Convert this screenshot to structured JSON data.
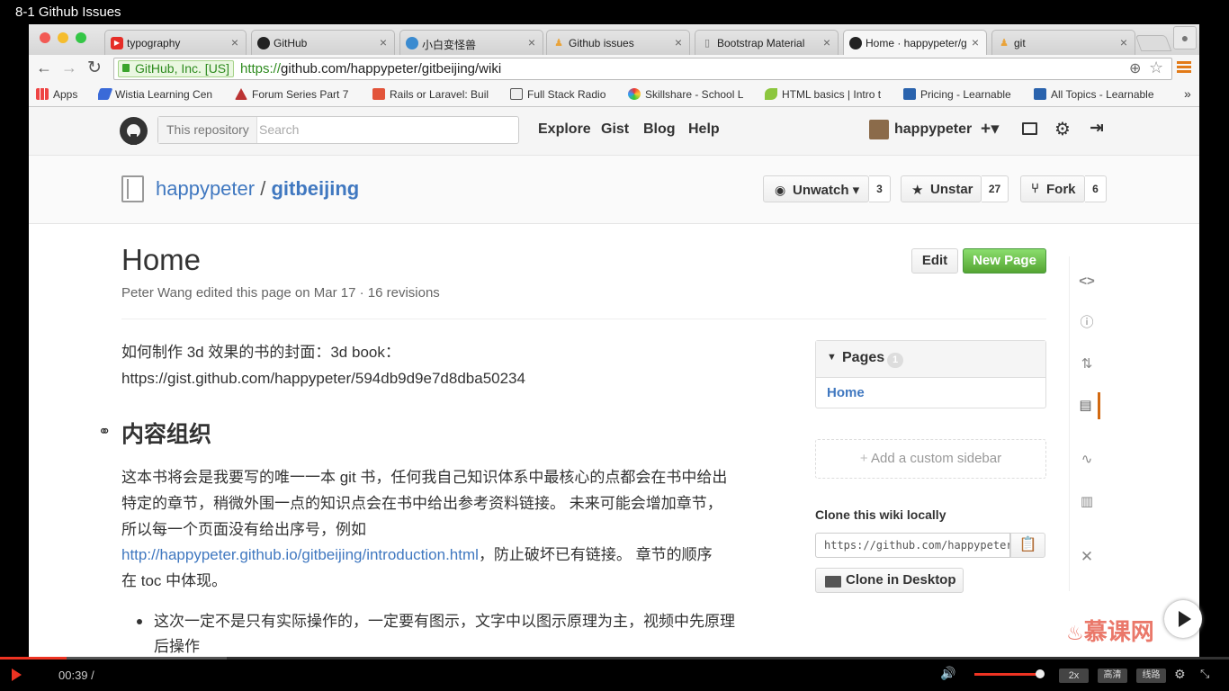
{
  "video": {
    "title": "8-1 Github Issues",
    "time": "00:39 /",
    "speed": "2x",
    "quality": "高清",
    "route": "线路",
    "watermark": "慕课网"
  },
  "browser": {
    "tabs": [
      {
        "label": "typography",
        "icon": "youtube-icon"
      },
      {
        "label": "GitHub",
        "icon": "github-icon"
      },
      {
        "label": "小白变怪兽",
        "icon": "earth-icon"
      },
      {
        "label": "Github issues",
        "icon": "people-icon"
      },
      {
        "label": "Bootstrap Material",
        "icon": "page-icon"
      },
      {
        "label": "Home · happypeter/g",
        "icon": "github-icon"
      },
      {
        "label": "git",
        "icon": "people-icon"
      }
    ],
    "ev_cert": "GitHub, Inc. [US]",
    "url_scheme": "https://",
    "url_rest": "github.com/happypeter/gitbeijing/wiki",
    "bookmarks": [
      "Apps",
      "Wistia Learning Cen",
      "Forum Series Part 7",
      "Rails or Laravel: Buil",
      "Full Stack Radio",
      "Skillshare - School L",
      "HTML basics | Intro t",
      "Pricing - Learnable",
      "All Topics - Learnable"
    ],
    "bookmarks_more": "»"
  },
  "github": {
    "search_scope": "This repository",
    "search_placeholder": "Search",
    "nav": [
      "Explore",
      "Gist",
      "Blog",
      "Help"
    ],
    "username": "happypeter",
    "plus": "+▾",
    "owner": "happypeter",
    "sep": "/",
    "repo": "gitbeijing",
    "unwatch": "Unwatch ▾",
    "watch_count": "3",
    "unstar": "Unstar",
    "star_count": "27",
    "fork": "Fork",
    "fork_count": "6"
  },
  "wiki": {
    "title": "Home",
    "meta": "Peter Wang edited this page on Mar 17 · 16 revisions",
    "edit": "Edit",
    "new_page": "New Page",
    "intro": "如何制作 3d 效果的书的封面：3d book：",
    "intro_link": "https://gist.github.com/happypeter/594db9d9e7d8dba50234",
    "h2": "内容组织",
    "para1a": "这本书将会是我要写的唯一一本 git 书，任何我自己知识体系中最核心的点都会在书中给出",
    "para1b": "特定的章节，稍微外围一点的知识点会在书中给出参考资料链接。 未来可能会增加章节，",
    "para1c": "所以每一个页面没有给出序号，例如",
    "para1_link": "http://happypeter.github.io/gitbeijing/introduction.html",
    "para1d": "，防止破坏已有链接。 章节的顺序",
    "para1e": "在 toc 中体现。",
    "bullet1a": "这次一定不是只有实际操作的，一定要有图示，文字中以图示原理为主，视频中先原理",
    "bullet1b": "后操作",
    "pages_label": "Pages",
    "pages_count": "1",
    "pages_home": "Home",
    "add_sidebar": "Add a custom sidebar",
    "clone_title": "Clone this wiki locally",
    "clone_url": "https://github.com/happypeter/gitbeijing.wiki.git",
    "clone_desktop": "Clone in Desktop"
  },
  "colors": {
    "accent": "#4078c0",
    "green": "#55a532",
    "player_red": "#e32"
  }
}
